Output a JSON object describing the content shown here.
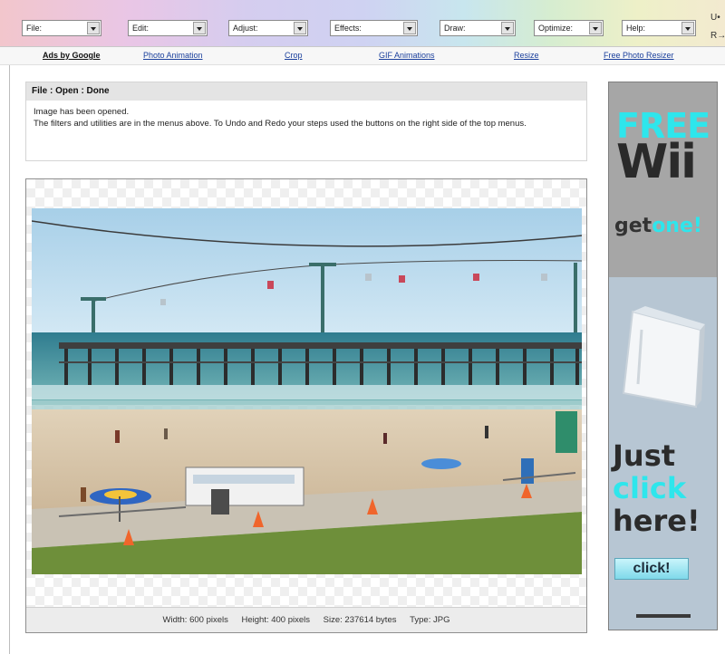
{
  "menu": [
    {
      "label": "File:"
    },
    {
      "label": "Edit:"
    },
    {
      "label": "Adjust:"
    },
    {
      "label": "Effects:"
    },
    {
      "label": "Draw:"
    },
    {
      "label": "Optimize:"
    },
    {
      "label": "Help:"
    }
  ],
  "undo_redo": {
    "undo": "U•",
    "redo": "R→"
  },
  "links": {
    "ads": "Ads by Google",
    "l1": "Photo Animation",
    "l2": "Crop",
    "l3": "GIF Animations",
    "l4": "Resize",
    "l5": "Free Photo Resizer"
  },
  "status": {
    "title": "File : Open : Done",
    "line1": "Image has been opened.",
    "line2": "The filters and utilities are in the menus above. To Undo and Redo your steps used the buttons on the right side of the top menus."
  },
  "image_info": {
    "width": "Width: 600 pixels",
    "height": "Height: 400 pixels",
    "size": "Size: 237614 bytes",
    "type": "Type: JPG"
  },
  "ad": {
    "free": "FREE",
    "wii": "Wii",
    "get": "get",
    "one": "one!",
    "just": "Just",
    "click_word": "click",
    "here": "here!",
    "button": "click!"
  },
  "colors": {
    "accent_cyan": "#2ee6ec",
    "link_blue": "#1a3f9c"
  }
}
